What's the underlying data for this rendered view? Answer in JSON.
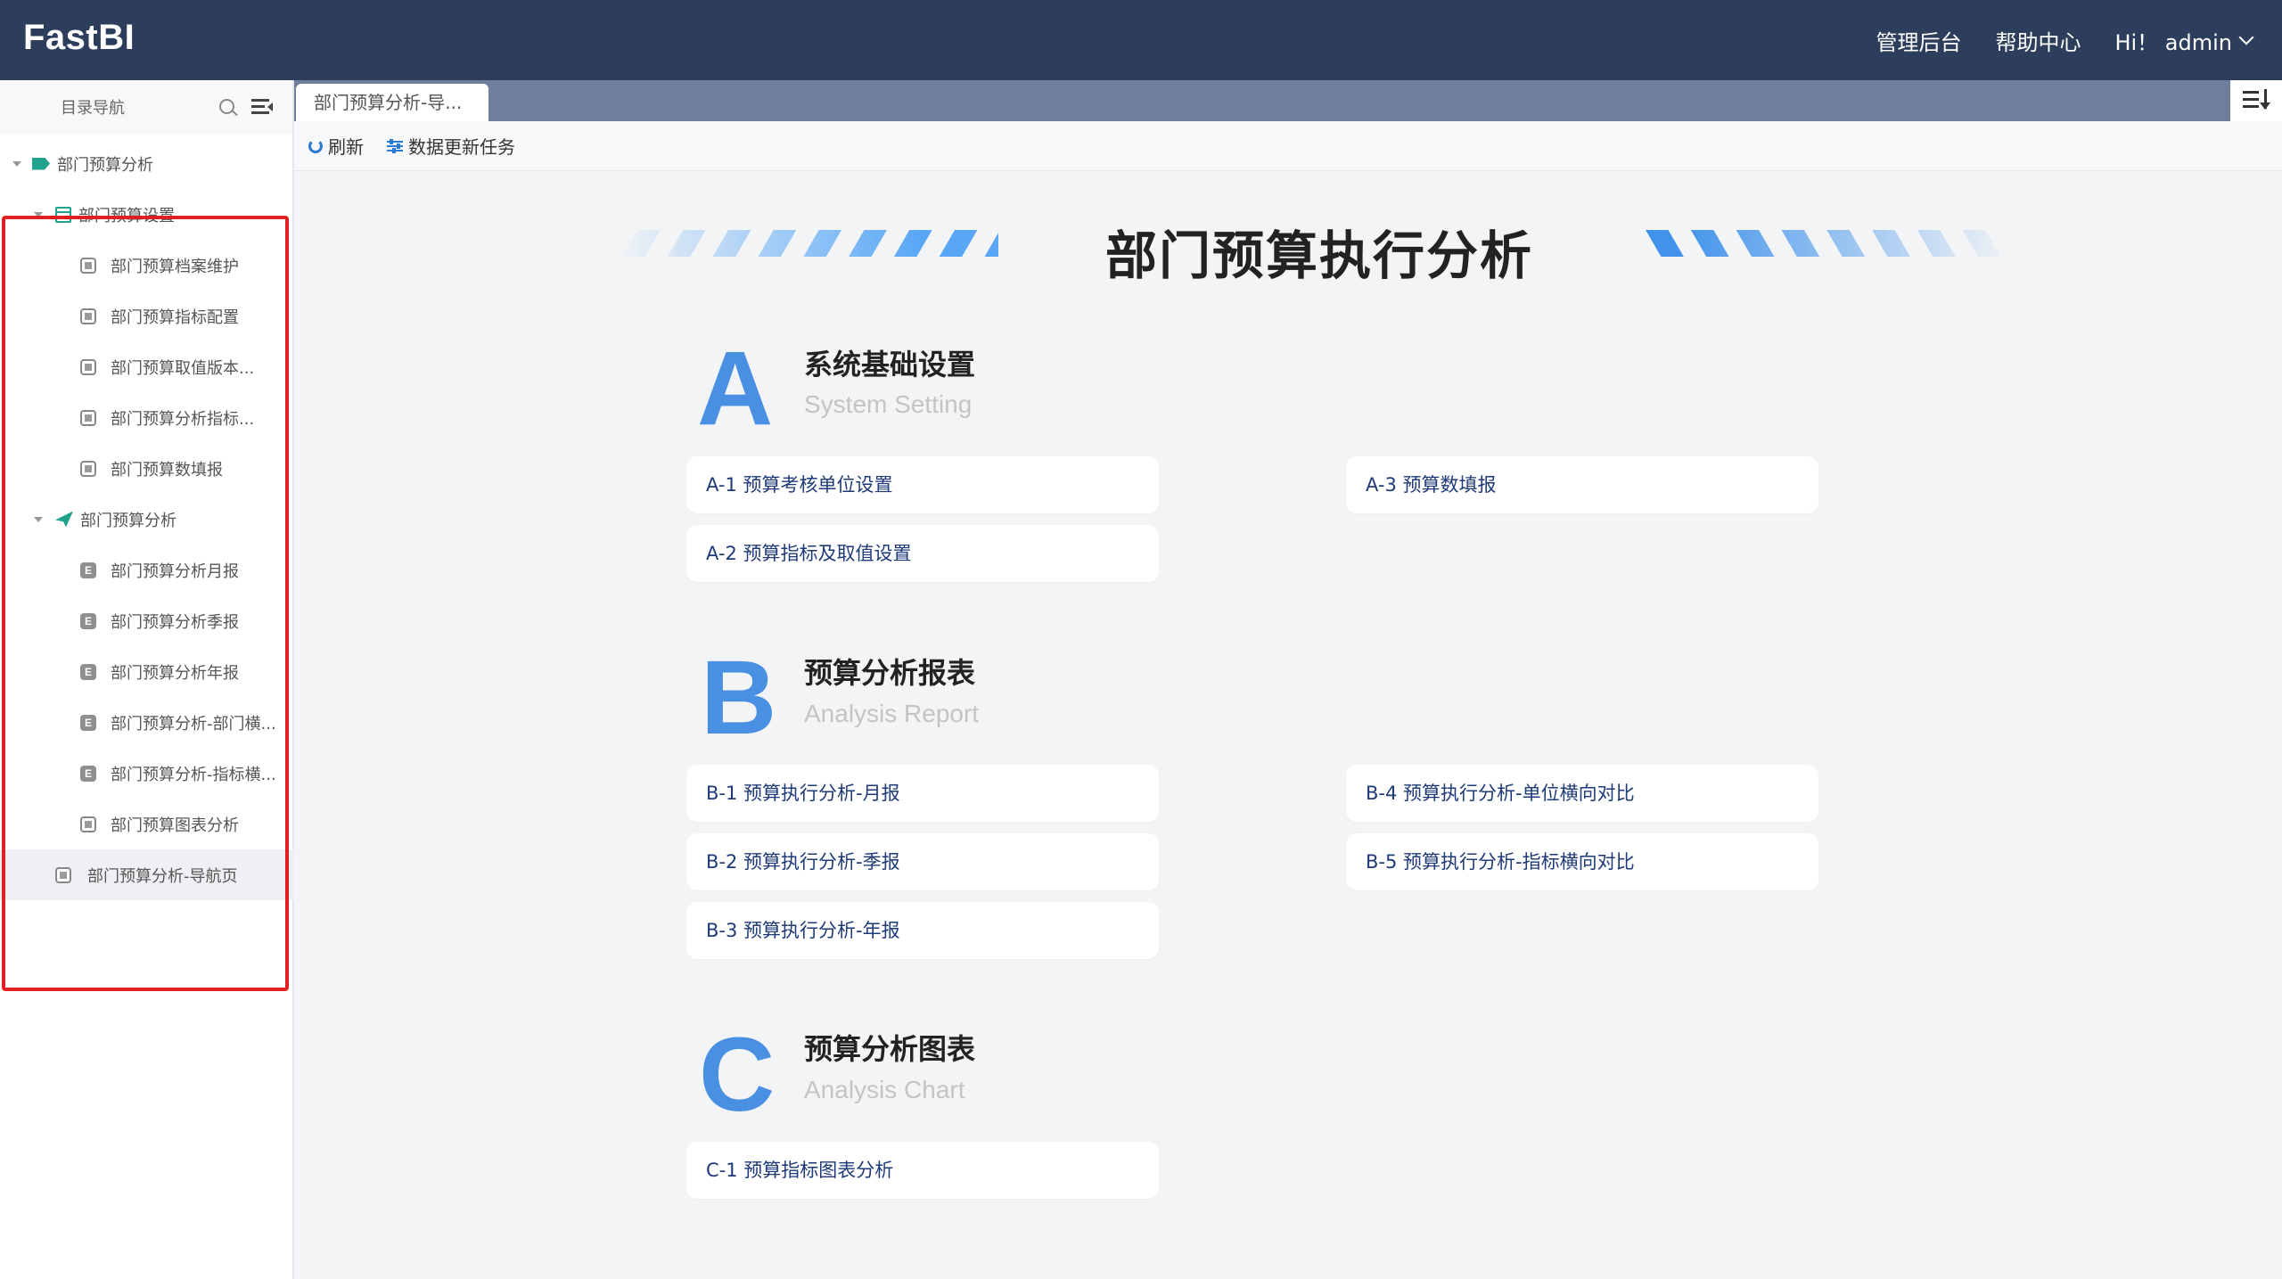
{
  "header": {
    "logo": "FastBI",
    "nav": [
      "管理后台",
      "帮助中心"
    ],
    "user": "Hi！ admin"
  },
  "sidebar": {
    "title": "目录导航",
    "tree": [
      {
        "label": "部门预算分析",
        "icon": "tag-icon",
        "level": 0
      },
      {
        "label": "部门预算设置",
        "icon": "calendar-icon",
        "level": 1
      },
      {
        "label": "部门预算档案维护",
        "icon": "document-icon",
        "level": 2
      },
      {
        "label": "部门预算指标配置",
        "icon": "document-icon",
        "level": 2
      },
      {
        "label": "部门预算取值版本...",
        "icon": "document-icon",
        "level": 2
      },
      {
        "label": "部门预算分析指标...",
        "icon": "document-icon",
        "level": 2
      },
      {
        "label": "部门预算数填报",
        "icon": "document-icon",
        "level": 2
      },
      {
        "label": "部门预算分析",
        "icon": "paper-plane-icon",
        "level": 1
      },
      {
        "label": "部门预算分析月报",
        "icon": "excel-icon",
        "level": 2
      },
      {
        "label": "部门预算分析季报",
        "icon": "excel-icon",
        "level": 2
      },
      {
        "label": "部门预算分析年报",
        "icon": "excel-icon",
        "level": 2
      },
      {
        "label": "部门预算分析-部门横...",
        "icon": "excel-icon",
        "level": 2
      },
      {
        "label": "部门预算分析-指标横...",
        "icon": "excel-icon",
        "level": 2
      },
      {
        "label": "部门预算图表分析",
        "icon": "document-icon",
        "level": 2
      },
      {
        "label": "部门预算分析-导航页",
        "icon": "document-icon",
        "level": 1
      }
    ]
  },
  "tabs": {
    "active": "部门预算分析-导..."
  },
  "toolbar": {
    "refresh": "刷新",
    "update_task": "数据更新任务"
  },
  "main": {
    "title": "部门预算执行分析",
    "sections": [
      {
        "letter": "A",
        "title_cn": "系统基础设置",
        "title_en": "System Setting",
        "items": [
          "A-1 预算考核单位设置",
          "A-2 预算指标及取值设置",
          "A-3 预算数填报"
        ]
      },
      {
        "letter": "B",
        "title_cn": "预算分析报表",
        "title_en": "Analysis Report",
        "items": [
          "B-1 预算执行分析-月报",
          "B-2 预算执行分析-季报",
          "B-3 预算执行分析-年报",
          "B-4 预算执行分析-单位横向对比",
          "B-5 预算执行分析-指标横向对比"
        ]
      },
      {
        "letter": "C",
        "title_cn": "预算分析图表",
        "title_en": "Analysis Chart",
        "items": [
          "C-1 预算指标图表分析"
        ]
      }
    ]
  }
}
